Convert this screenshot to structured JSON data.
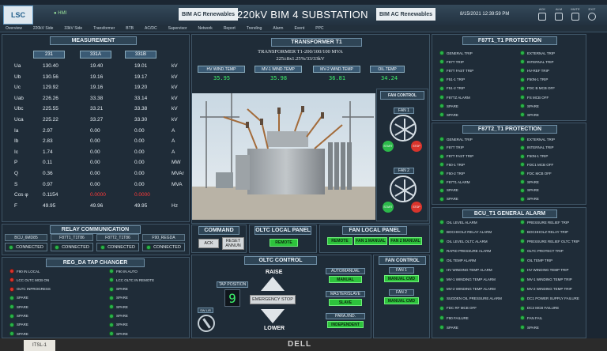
{
  "header": {
    "logo": "LSC",
    "hmi_label": "● HMI",
    "brand_left": "BIM AC Renewables",
    "title": "220kV BIM 4 SUBSTATION",
    "brand_right": "BIM AC Renewables",
    "datetime": "8/15/2021 12:39:59 PM",
    "icons": [
      "ack-icon",
      "alarm-bell-icon",
      "mute-icon",
      "power-icon"
    ],
    "icon_labels": [
      "ACK",
      "ALM",
      "MUTE",
      "EXIT"
    ]
  },
  "nav": [
    "Overview",
    "220kV Side",
    "33kV Side",
    "Transformer",
    "BTB",
    "AC/DC",
    "Supervisor",
    "Network",
    "Report",
    "Trending",
    "Alarm",
    "Event",
    "PPC"
  ],
  "measurement": {
    "title": "MEASUREMENT",
    "columns": [
      "231",
      "331A",
      "331B"
    ],
    "rows": [
      {
        "label": "Ua",
        "v": [
          "130.40",
          "19.40",
          "19.01"
        ],
        "unit": "kV"
      },
      {
        "label": "Ub",
        "v": [
          "130.56",
          "19.16",
          "19.17"
        ],
        "unit": "kV"
      },
      {
        "label": "Uc",
        "v": [
          "129.92",
          "19.16",
          "19.20"
        ],
        "unit": "kV"
      },
      {
        "label": "Uab",
        "v": [
          "226.26",
          "33.38",
          "33.14"
        ],
        "unit": "kV"
      },
      {
        "label": "Ubc",
        "v": [
          "225.55",
          "33.21",
          "33.38"
        ],
        "unit": "kV"
      },
      {
        "label": "Uca",
        "v": [
          "225.22",
          "33.27",
          "33.30"
        ],
        "unit": "kV"
      },
      {
        "label": "Ia",
        "v": [
          "2.97",
          "0.00",
          "0.00"
        ],
        "unit": "A"
      },
      {
        "label": "Ib",
        "v": [
          "2.83",
          "0.00",
          "0.00"
        ],
        "unit": "A"
      },
      {
        "label": "Ic",
        "v": [
          "1.74",
          "0.00",
          "0.00"
        ],
        "unit": "A"
      },
      {
        "label": "P",
        "v": [
          "0.11",
          "0.00",
          "0.00"
        ],
        "unit": "MW"
      },
      {
        "label": "Q",
        "v": [
          "0.36",
          "0.00",
          "0.00"
        ],
        "unit": "MVAr"
      },
      {
        "label": "S",
        "v": [
          "0.97",
          "0.00",
          "0.00"
        ],
        "unit": "MVA"
      },
      {
        "label": "Cos φ",
        "v": [
          "0.1154",
          "0.0000",
          "0.0000"
        ],
        "unit": ""
      },
      {
        "label": "F",
        "v": [
          "49.95",
          "49.96",
          "49.95"
        ],
        "unit": "Hz"
      }
    ]
  },
  "relay": {
    "title": "RELAY COMMUNICATION",
    "items": [
      {
        "name": "BCU_6MD85",
        "status": "CONNECTED"
      },
      {
        "name": "F87T1_T1T86",
        "status": "CONNECTED"
      },
      {
        "name": "F87T2_T1T86",
        "status": "CONNECTED"
      },
      {
        "name": "F90_REGDA",
        "status": "CONNECTED"
      }
    ]
  },
  "tap_changer": {
    "title": "REG_DA TAP CHANGER",
    "left": [
      {
        "t": "F90 IN LOCAL",
        "s": "red"
      },
      {
        "t": "LCC OLTC MCB ON",
        "s": "red"
      },
      {
        "t": "OLTC INPROGRESS",
        "s": "red"
      },
      {
        "t": "SPARE",
        "s": "green"
      },
      {
        "t": "SPARE",
        "s": "green"
      },
      {
        "t": "SPARE",
        "s": "green"
      },
      {
        "t": "SPARE",
        "s": "green"
      },
      {
        "t": "SPARE",
        "s": "green"
      }
    ],
    "right": [
      {
        "t": "F90 IN AUTO",
        "s": "green"
      },
      {
        "t": "LCC OLTC IN REMOTE",
        "s": "green"
      },
      {
        "t": "SPARE",
        "s": "green"
      },
      {
        "t": "SPARE",
        "s": "green"
      },
      {
        "t": "SPARE",
        "s": "green"
      },
      {
        "t": "SPARE",
        "s": "green"
      },
      {
        "t": "SPARE",
        "s": "green"
      },
      {
        "t": "SPARE",
        "s": "green"
      }
    ]
  },
  "transformer": {
    "title": "TRANSFORMER T1",
    "spec1": "TRANSFORMER T1-200/100/100 MVA",
    "spec2": "225±8x1.25%/33/33kV",
    "temps": [
      {
        "label": "HV WIND.TEMP",
        "value": "35.95"
      },
      {
        "label": "MV-1 WIND.TEMP",
        "value": "35.98"
      },
      {
        "label": "MV-2 WIND.TEMP",
        "value": "36.81"
      },
      {
        "label": "OIL.TEMP",
        "value": "34.24"
      }
    ]
  },
  "fan_control_top": {
    "title": "FAN CONTROL",
    "fan1": "FAN 1",
    "fan2": "FAN 2",
    "start": "START",
    "stop": "STOP"
  },
  "command": {
    "title": "COMMAND",
    "ack": "ACK",
    "reset": "RESET ANNUN"
  },
  "oltc_local": {
    "title": "OLTC LOCAL PANEL",
    "state": "REMOTE"
  },
  "fan_local": {
    "title": "FAN LOCAL PANEL",
    "remote": "REMOTE",
    "fan1": "FAN 1 MANUAL",
    "fan2": "FAN 2 MANUAL"
  },
  "oltc_control": {
    "title": "OLTC CONTROL",
    "raise": "RAISE",
    "lower": "LOWER",
    "emergency": "EMERGENCY STOP",
    "tap_label": "TAP POSITION",
    "tap_value": "9",
    "sw_label": "SW L/R",
    "auto_manual": "AUTO/MANUAL",
    "auto_manual_state": "MANUAL",
    "master_slave": "MASTER/SLAVE",
    "master_slave_state": "SLAVE",
    "para_ind": "PARA./IND.",
    "para_ind_state": "INDEPENDENT"
  },
  "fan_control_bottom": {
    "title": "FAN CONTROL",
    "fan1": "FAN 1",
    "fan1_state": "MANUAL CMD",
    "fan2": "FAN 2",
    "fan2_state": "MANUAL CMD"
  },
  "f87t1": {
    "title": "F87T1_T1 PROTECTION",
    "left": [
      "GENERAL TRIP",
      "F87T TRIP",
      "F87T FAST TRIP",
      "F51-1 TRIP",
      "F51-2 TRIP",
      "F87TZ ALARM",
      "SPARE",
      "SPARE"
    ],
    "right": [
      "EXTERNAL TRIP",
      "INTERNAL TRIP",
      "HV-REF TRIP",
      "F50N-1 TRIP",
      "FDC B MCB OFF",
      "FS MCB OFF",
      "SPARE",
      "SPARE"
    ]
  },
  "f87t2": {
    "title": "F87T2_T1 PROTECTION",
    "left": [
      "GENERAL TRIP",
      "F87T TRIP",
      "F87T FAST TRIP",
      "F50-1 TRIP",
      "F50-2 TRIP",
      "F87T1 ALARM",
      "SPARE",
      "SPARE"
    ],
    "right": [
      "EXTERNAL TRIP",
      "INTERNAL TRIP",
      "F50N-1 TRIP",
      "FDC1 MCB OFF",
      "FDC MCB OFF",
      "SPARE",
      "SPARE",
      "SPARE"
    ]
  },
  "bcu": {
    "title": "BCU_T1 GENERAL ALARM",
    "left": [
      "OIL LEVEL ALARM",
      "BOCHHOLZ RELAY ALARM",
      "OIL LEVEL OLTC ALARM",
      "RAPID PRESSURE ALARM",
      "OIL TEMP ALARM",
      "HV WINDING TEMP ALARM",
      "MV-1 WINDING TEMP ALARM",
      "MV-2 WINDING TEMP ALARM",
      "SUDDEN OIL PRESSURE ALARM",
      "FDC RF MCB OFF",
      "F90 FAILURE",
      "SPARE"
    ],
    "right": [
      "PRESSURE RELIEF TRIP",
      "BOCHHOLZ RELAY TRIP",
      "PRESSURE RELIEF OLTC TRIP",
      "OLTC PROTECT TRIP",
      "OIL TEMP TRIP",
      "HV WINDING TEMP TRIP",
      "MV-1 WINDING TEMP TRIP",
      "MV-2 WINDING TEMP TRIP",
      "DC1 POWER SUPPLY FAILURE",
      "DC2 MCB FAILURE",
      "FAN FAIL",
      "SPARE"
    ]
  },
  "monitor": {
    "brand": "DELL",
    "sticker": "ITSL-1"
  }
}
